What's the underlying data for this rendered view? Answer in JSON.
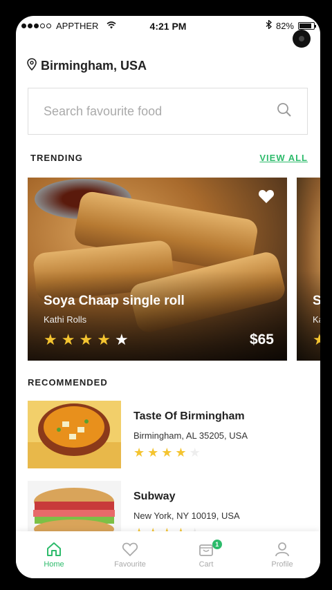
{
  "status_bar": {
    "carrier": "APPTHER",
    "time": "4:21 PM",
    "battery": "82%"
  },
  "location": {
    "label": "Birmingham, USA"
  },
  "search": {
    "placeholder": "Search favourite food"
  },
  "trending": {
    "title": "TRENDING",
    "view_all": "VIEW ALL",
    "cards": [
      {
        "name": "Soya Chaap single roll",
        "subtitle": "Kathi Rolls",
        "rating": 4,
        "price": "$65",
        "favourited": true
      },
      {
        "name": "S",
        "subtitle": "Ka",
        "rating": 1
      }
    ]
  },
  "recommended": {
    "title": "RECOMMENDED",
    "items": [
      {
        "name": "Taste Of Birmingham",
        "address": "Birmingham, AL 35205, USA",
        "rating": 4
      },
      {
        "name": "Subway",
        "address": "New York, NY 10019, USA",
        "rating": 4
      }
    ]
  },
  "tabbar": {
    "tabs": [
      {
        "label": "Home",
        "icon": "home-icon",
        "active": true
      },
      {
        "label": "Favourite",
        "icon": "heart-icon",
        "active": false
      },
      {
        "label": "Cart",
        "icon": "cart-icon",
        "active": false,
        "badge": "1"
      },
      {
        "label": "Profile",
        "icon": "user-icon",
        "active": false
      }
    ]
  },
  "colors": {
    "accent": "#2dbb6b",
    "star": "#f4c430"
  }
}
